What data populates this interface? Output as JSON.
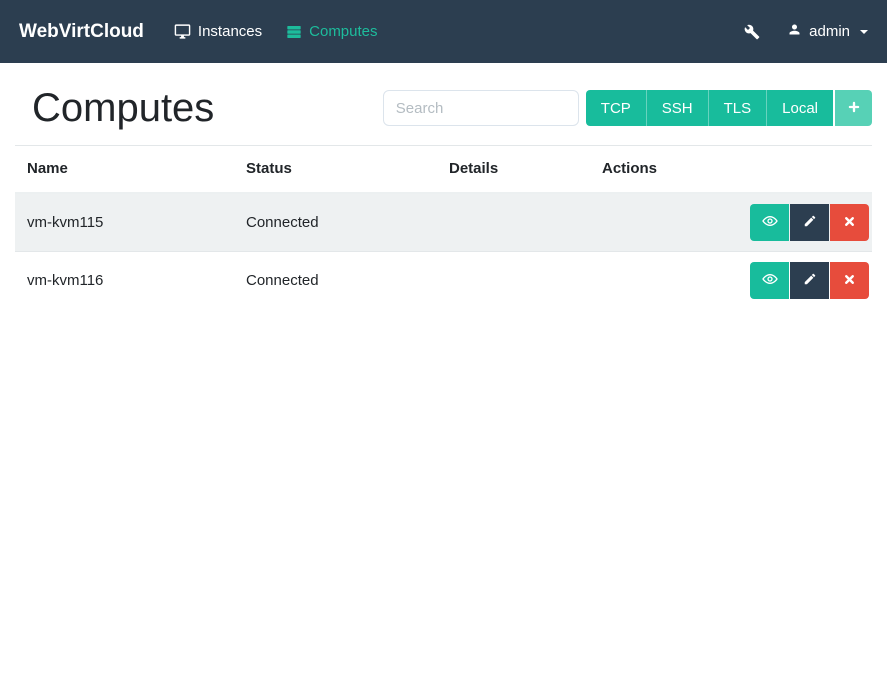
{
  "navbar": {
    "brand": "WebVirtCloud",
    "items": [
      {
        "label": "Instances",
        "icon": "desktop-icon",
        "active": false
      },
      {
        "label": "Computes",
        "icon": "server-icon",
        "active": true
      }
    ],
    "tools_icon": "wrench-icon",
    "user": {
      "label": "admin",
      "icon": "user-icon",
      "caret": "caret-down-icon"
    }
  },
  "page": {
    "title": "Computes",
    "search": {
      "placeholder": "Search",
      "value": ""
    },
    "type_buttons": [
      "TCP",
      "SSH",
      "TLS",
      "Local"
    ],
    "add_button_icon": "plus-icon"
  },
  "table": {
    "headers": [
      "Name",
      "Status",
      "Details",
      "Actions"
    ],
    "rows": [
      {
        "name": "vm-kvm115",
        "status": "Connected",
        "details": ""
      },
      {
        "name": "vm-kvm116",
        "status": "Connected",
        "details": ""
      }
    ],
    "row_action_icons": [
      "eye-icon",
      "pencil-icon",
      "x-icon"
    ]
  },
  "colors": {
    "navbar_bg": "#2c3e50",
    "accent_teal": "#18bc9c",
    "add_button_teal_light": "#57d1b6",
    "edit_dark": "#2c3e50",
    "danger_red": "#e74c3c",
    "stripe_bg": "#eef1f2",
    "border": "#e3e7e9"
  }
}
